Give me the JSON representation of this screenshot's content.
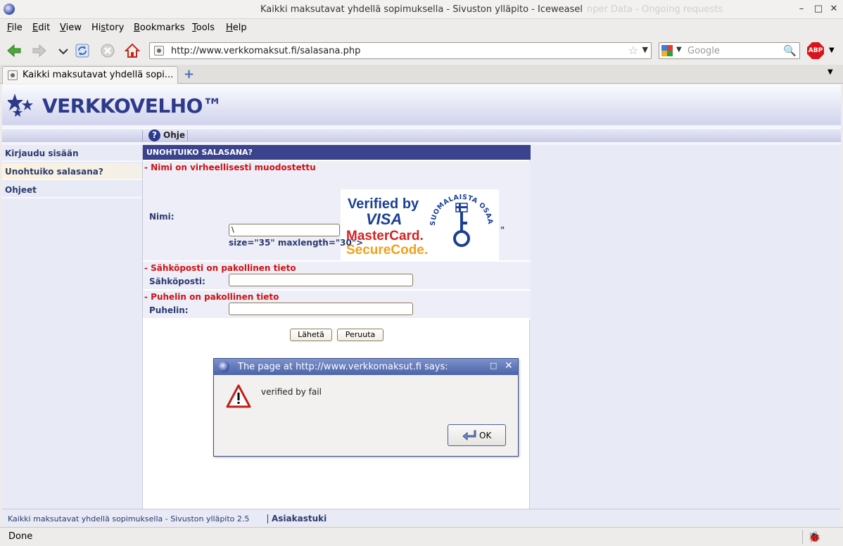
{
  "window": {
    "title": "Kaikki maksutavat yhdellä sopimuksella - Sivuston ylläpito - Iceweasel",
    "ghost_title": "nper Data - Ongoing requests"
  },
  "menu": {
    "items": [
      {
        "pre": "",
        "u": "F",
        "post": "ile"
      },
      {
        "pre": "",
        "u": "E",
        "post": "dit"
      },
      {
        "pre": "",
        "u": "V",
        "post": "iew"
      },
      {
        "pre": "Hi",
        "u": "s",
        "post": "tory"
      },
      {
        "pre": "",
        "u": "B",
        "post": "ookmarks"
      },
      {
        "pre": "",
        "u": "T",
        "post": "ools"
      },
      {
        "pre": "",
        "u": "H",
        "post": "elp"
      }
    ]
  },
  "toolbar": {
    "url": "http://www.verkkomaksut.fi/salasana.php",
    "search_placeholder": "Google",
    "adblock_label": "ABP"
  },
  "tabs": [
    {
      "label": "Kaikki maksutavat yhdellä sopi..."
    }
  ],
  "site": {
    "logo_text": "VERKKOVELHO™",
    "nav_help": "Ohje",
    "sidebar": [
      {
        "label": "Kirjaudu sisään",
        "active": false
      },
      {
        "label": "Unohtuiko salasana?",
        "active": true
      },
      {
        "label": "Ohjeet",
        "active": false
      }
    ],
    "form": {
      "heading": "UNOHTUIKO SALASANA?",
      "name": {
        "error": "- Nimi on virheellisesti muodostettu",
        "label": "Nimi:",
        "value": "\\",
        "trailing_quote": "\"",
        "junk_text": "size=\"35\" maxlength=\"30\">"
      },
      "email": {
        "error": "- Sähköposti on pakollinen tieto",
        "label": "Sähköposti:",
        "value": ""
      },
      "phone": {
        "error": "- Puhelin on pakollinen tieto",
        "label": "Puhelin:",
        "value": ""
      },
      "submit_label": "Lähetä",
      "cancel_label": "Peruuta"
    },
    "badge": {
      "line1": "Verified by",
      "line2": "VISA",
      "line3": "MasterCard.",
      "line4": "SecureCode.",
      "seal_text": "SUOMALAISTA OSAAMISTA"
    },
    "footer_text": "Kaikki maksutavat yhdellä sopimuksella - Sivuston ylläpito 2.5",
    "footer_link": "Asiakastuki"
  },
  "dialog": {
    "title": "The page at http://www.verkkomaksut.fi says:",
    "message": "verified by fail",
    "ok_label": "OK"
  },
  "status": {
    "text": "Done"
  },
  "colors": {
    "brand_navy": "#3c438d",
    "error_red": "#d21111",
    "link_text": "#2c3a6e"
  }
}
